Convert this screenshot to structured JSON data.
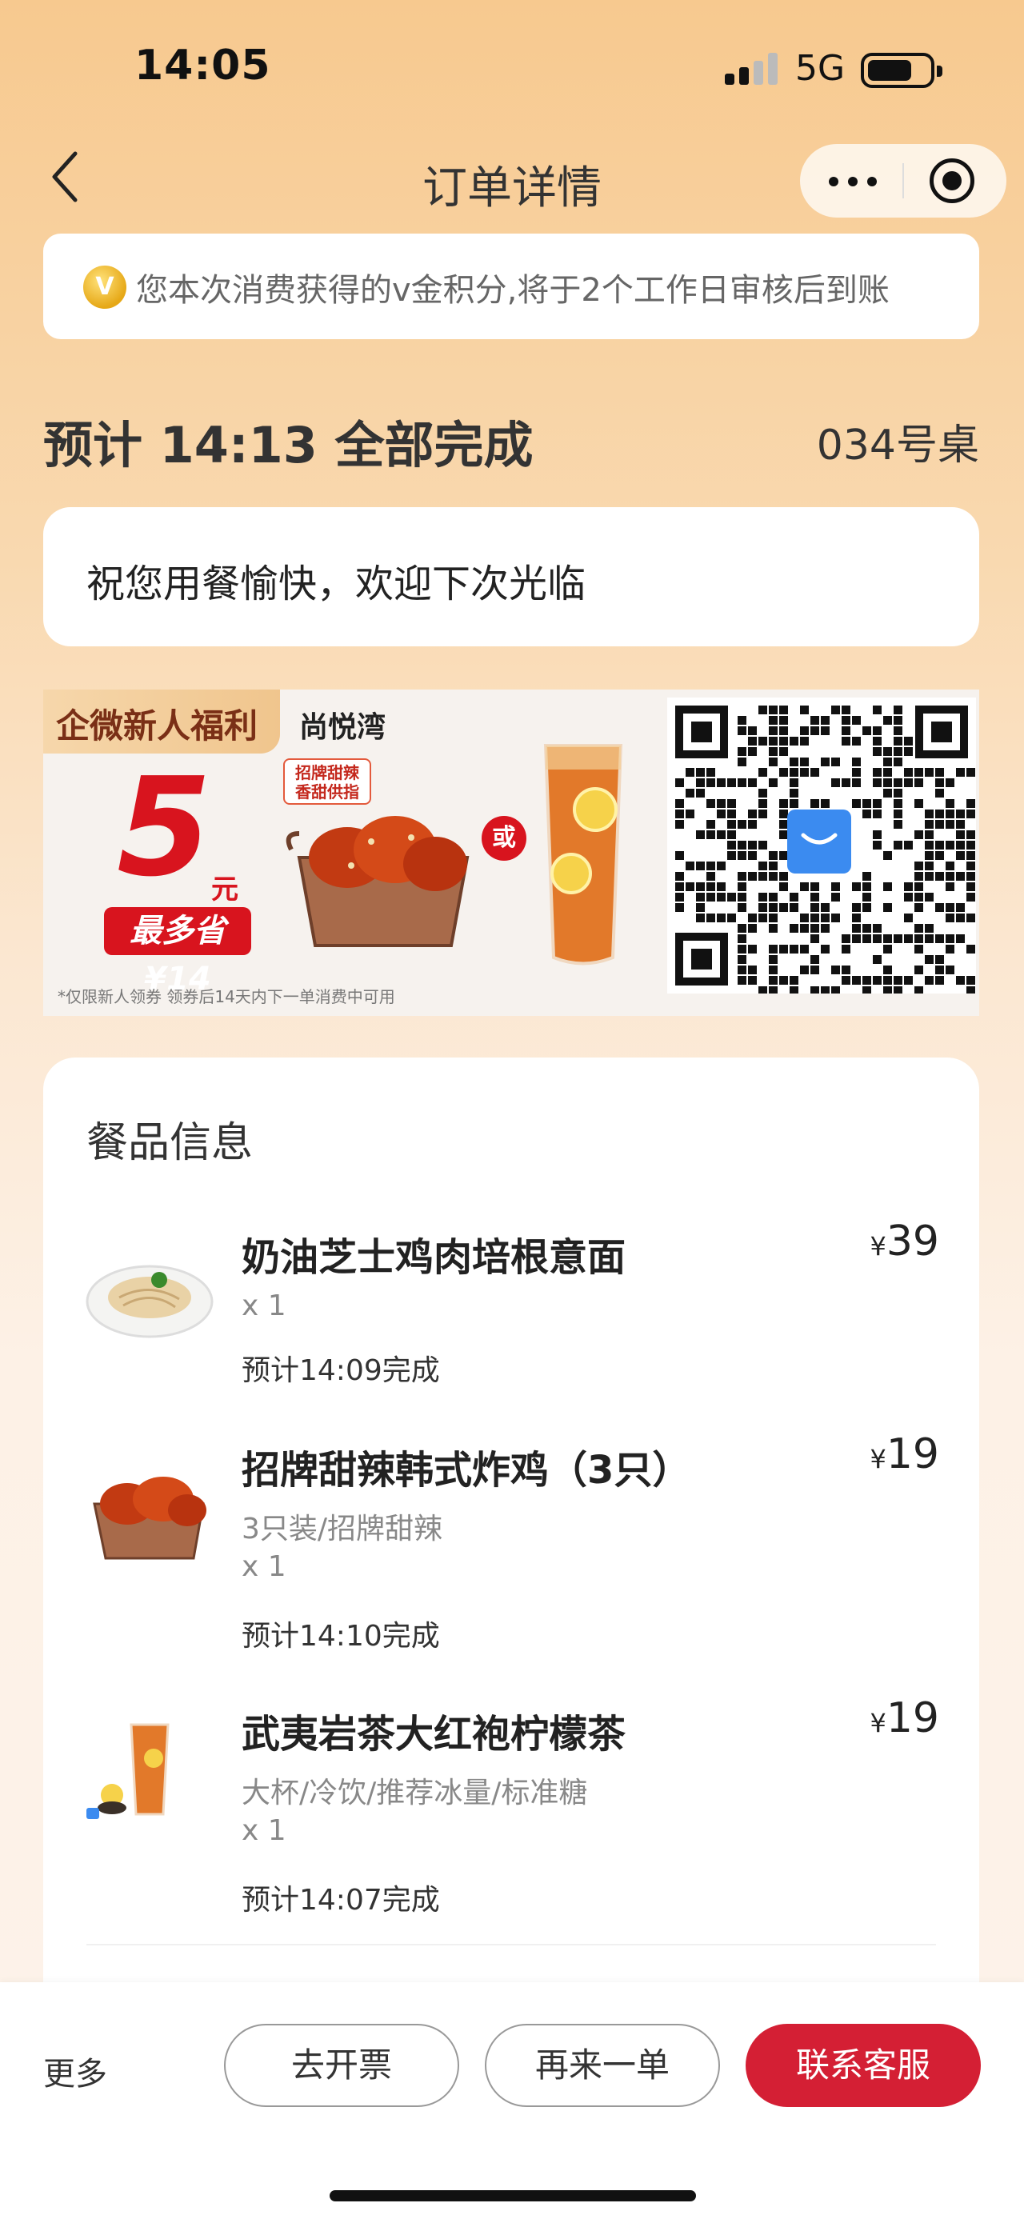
{
  "status_bar": {
    "time": "14:05",
    "network": "5G"
  },
  "nav": {
    "title": "订单详情",
    "back_icon": "chevron-left-icon",
    "more_icon": "more-dots-icon",
    "close_icon": "target-close-icon"
  },
  "points_notice": {
    "badge": "V",
    "text": "您本次消费获得的v金积分,将于2个工作日审核后到账"
  },
  "order_status": {
    "title": "预计 14:13 全部完成",
    "table": "034号桌"
  },
  "greeting": "祝您用餐愉快，欢迎下次光临",
  "promo": {
    "tag": "企微新人福利",
    "store": "尚悦湾",
    "amount": "5",
    "unit": "元",
    "save": "最多省¥14",
    "sticker": "招牌甜辣 香甜供指",
    "or": "或",
    "fine_print": "*仅限新人领券  领券后14天内下一单消费中可用"
  },
  "food_info": {
    "title": "餐品信息",
    "items": [
      {
        "name": "奶油芝士鸡肉培根意面",
        "spec": "",
        "qty": "x 1",
        "eta": "预计14:09完成",
        "currency": "¥",
        "price": "39",
        "thumb_icon": "pasta-plate-icon"
      },
      {
        "name": "招牌甜辣韩式炸鸡（3只）",
        "spec": "3只装/招牌甜辣",
        "qty": "x 1",
        "eta": "预计14:10完成",
        "currency": "¥",
        "price": "19",
        "thumb_icon": "fried-chicken-icon"
      },
      {
        "name": "武夷岩茶大红袍柠檬茶",
        "spec": "大杯/冷饮/推荐冰量/标准糖",
        "qty": "x 1",
        "eta": "预计14:07完成",
        "currency": "¥",
        "price": "19",
        "thumb_icon": "lemon-tea-icon"
      }
    ]
  },
  "bottom_bar": {
    "more": "更多",
    "invoice": "去开票",
    "reorder": "再来一单",
    "contact": "联系客服"
  },
  "colors": {
    "accent": "#d41f34",
    "price_red": "#d8141e",
    "bg_top": "#f7c98f"
  }
}
